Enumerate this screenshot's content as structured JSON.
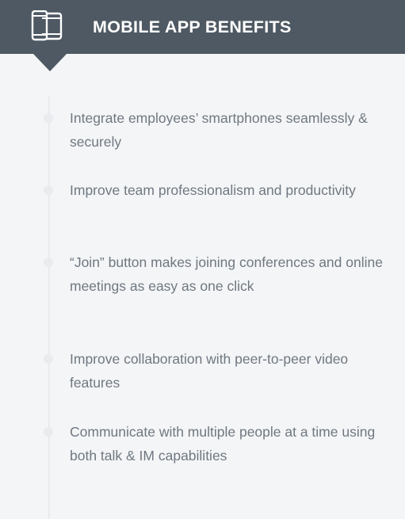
{
  "header": {
    "title": "MOBILE APP BENEFITS",
    "icon": "mobile-devices-icon",
    "background": "#4f5963",
    "text_color": "#ffffff"
  },
  "benefits": [
    {
      "text": "Integrate employees’ smartphones seamlessly & securely"
    },
    {
      "text": "Improve team professionalism and productivity"
    },
    {
      "text": "“Join” button makes joining conferences and online meetings as easy as one click"
    },
    {
      "text": "Improve collaboration with peer-to-peer video features"
    },
    {
      "text": "Communicate with multiple people at a time using both talk & IM capabilities"
    }
  ],
  "colors": {
    "panel_background": "#f4f5f7",
    "body_text": "#6f7880",
    "timeline": "#e9ebee"
  }
}
